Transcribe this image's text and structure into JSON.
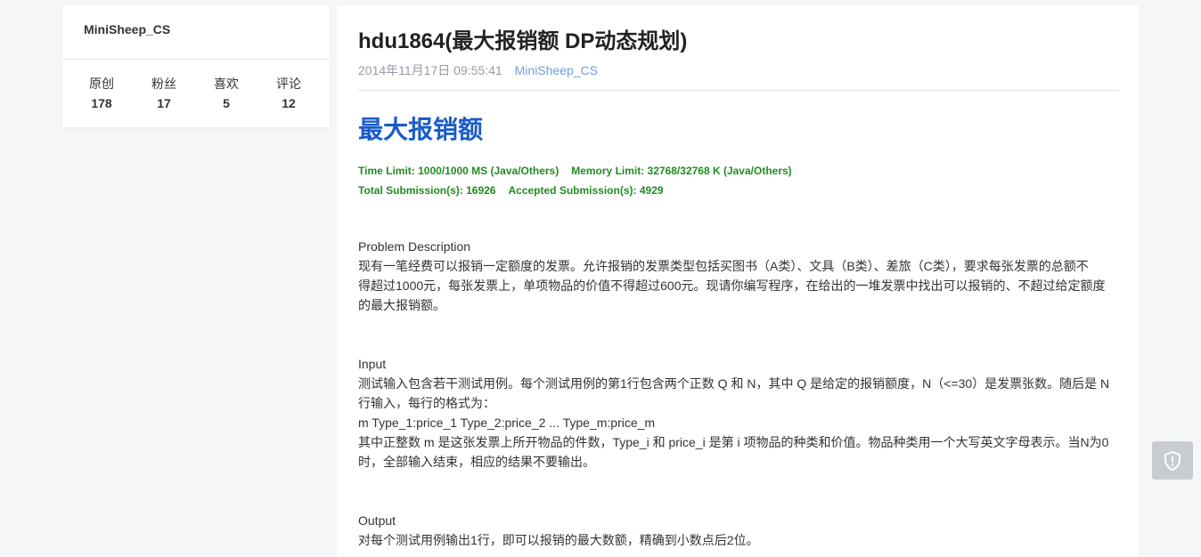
{
  "profile": {
    "name": "MiniSheep_CS",
    "stats": [
      {
        "label": "原创",
        "value": "178"
      },
      {
        "label": "粉丝",
        "value": "17"
      },
      {
        "label": "喜欢",
        "value": "5"
      },
      {
        "label": "评论",
        "value": "12"
      }
    ]
  },
  "article": {
    "title": "hdu1864(最大报销额 DP动态规划)",
    "date": "2014年11月17日 09:55:41",
    "author": "MiniSheep_CS",
    "problem_title": "最大报销额",
    "time_limit": "Time Limit: 1000/1000 MS (Java/Others)",
    "memory_limit": "Memory Limit: 32768/32768 K (Java/Others)",
    "total_submissions": "Total Submission(s): 16926",
    "accepted_submissions": "Accepted Submission(s): 4929",
    "description_heading": "Problem Description",
    "description_lines": [
      "现有一笔经费可以报销一定额度的发票。允许报销的发票类型包括买图书（A类）、文具（B类）、差旅（C类），要求每张发票的总额不",
      "得超过1000元，每张发票上，单项物品的价值不得超过600元。现请你编写程序，在给出的一堆发票中找出可以报销的、不超过给定额度",
      "的最大报销额。"
    ],
    "input_heading": "Input",
    "input_lines": [
      "测试输入包含若干测试用例。每个测试用例的第1行包含两个正数 Q 和 N，其中 Q 是给定的报销额度，N（<=30）是发票张数。随后是 N",
      "行输入，每行的格式为：",
      "m Type_1:price_1 Type_2:price_2 ... Type_m:price_m",
      "其中正整数 m 是这张发票上所开物品的件数，Type_i 和 price_i 是第 i 项物品的种类和价值。物品种类用一个大写英文字母表示。当N为0",
      "时，全部输入结束，相应的结果不要输出。"
    ],
    "output_heading": "Output",
    "output_lines": [
      "对每个测试用例输出1行，即可以报销的最大数额，精确到小数点后2位。"
    ]
  },
  "floating": {
    "icon": "shield-icon"
  },
  "colors": {
    "background": "#f5f6f7",
    "link": "#6b9fe0",
    "problem_title": "#1a5cc8",
    "limits": "#228b22"
  }
}
